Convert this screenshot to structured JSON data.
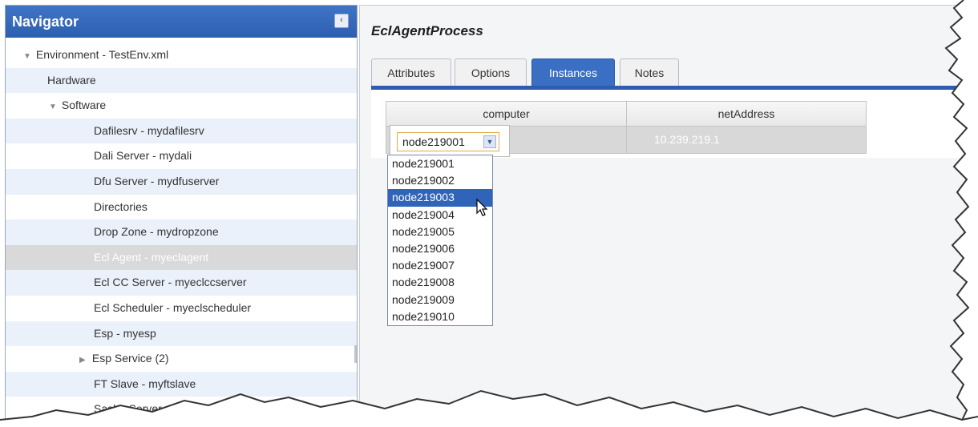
{
  "navigator": {
    "title": "Navigator",
    "collapse_glyph": "‹",
    "tree": [
      {
        "label": "Environment - TestEnv.xml",
        "level": 0,
        "expanded": true
      },
      {
        "label": "Hardware",
        "level": 1
      },
      {
        "label": "Software",
        "level": 1,
        "expanded": true
      },
      {
        "label": "Dafilesrv - mydafilesrv",
        "level": 2
      },
      {
        "label": "Dali Server - mydali",
        "level": 2
      },
      {
        "label": "Dfu Server - mydfuserver",
        "level": 2
      },
      {
        "label": "Directories",
        "level": 2
      },
      {
        "label": "Drop Zone - mydropzone",
        "level": 2
      },
      {
        "label": "Ecl Agent - myeclagent",
        "level": 2,
        "selected": true
      },
      {
        "label": "Ecl CC Server - myeclccserver",
        "level": 2
      },
      {
        "label": "Ecl Scheduler - myeclscheduler",
        "level": 2
      },
      {
        "label": "Esp - myesp",
        "level": 2
      },
      {
        "label": "Esp Service (2)",
        "level": 2,
        "collapsed": true
      },
      {
        "label": "FT Slave - myftslave",
        "level": 2
      },
      {
        "label": "Sasha Server - mysasha",
        "level": 2
      }
    ]
  },
  "content": {
    "title": "EclAgentProcess",
    "tabs": [
      "Attributes",
      "Options",
      "Instances",
      "Notes"
    ],
    "active_tab": "Instances",
    "grid": {
      "columns": [
        "computer",
        "netAddress"
      ],
      "rows": [
        {
          "computer": "node219001",
          "netAddress": "10.239.219.1"
        }
      ]
    },
    "select": {
      "value": "node219001",
      "options": [
        "node219001",
        "node219002",
        "node219003",
        "node219004",
        "node219005",
        "node219006",
        "node219007",
        "node219008",
        "node219009",
        "node219010"
      ],
      "highlighted": "node219003"
    }
  },
  "colors": {
    "accent": "#2c5db0",
    "header": "#3f74c6",
    "selected_row": "#d9d9d9",
    "alt_row": "#eaf1fb"
  }
}
